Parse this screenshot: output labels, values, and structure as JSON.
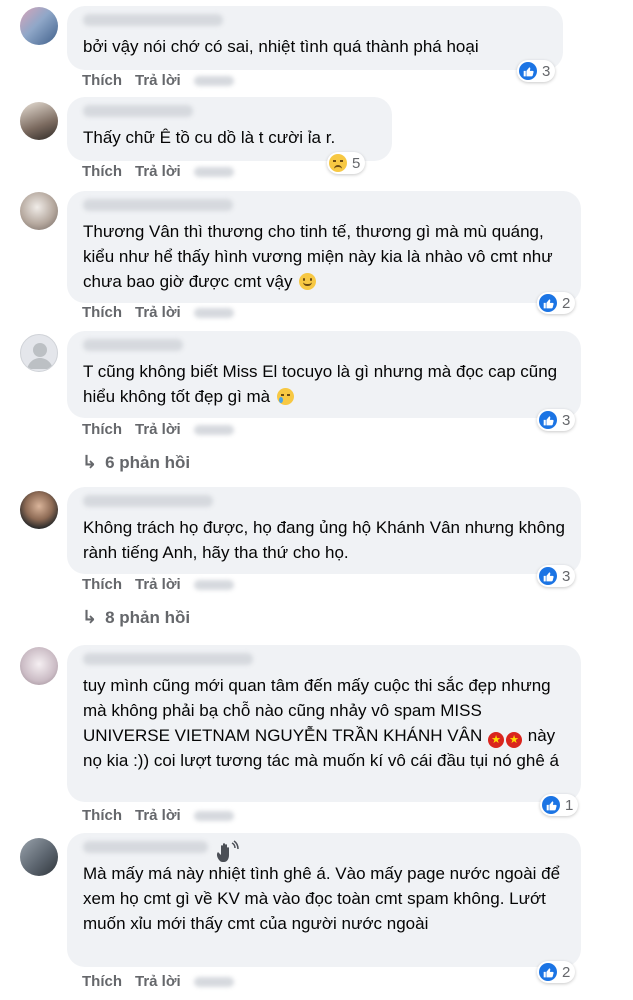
{
  "comments": [
    {
      "text": "bởi vậy nói chớ có sai, nhiệt tình quá thành phá hoại",
      "reaction": "like",
      "count": "3"
    },
    {
      "text": "Thấy chữ Ê tồ cu dồ là t cười ỉa r.",
      "reaction": "sad",
      "count": "5"
    },
    {
      "text": "Thương Vân thì thương cho tinh tế, thương gì mà mù quáng, kiểu như hể thấy hình vương miện này kia là nhào vô cmt như chưa bao giờ được cmt vậy",
      "reaction": "like",
      "count": "2"
    },
    {
      "text": "T cũng không biết Miss El tocuyo là gì nhưng mà đọc cap cũng hiểu không tốt đẹp gì mà",
      "reaction": "like",
      "count": "3",
      "replies": "6 phản hồi"
    },
    {
      "text": "Không trách họ được, họ đang ủng hộ Khánh Vân nhưng không rành tiếng Anh, hãy tha thứ cho họ.",
      "reaction": "like",
      "count": "3",
      "replies": "8 phản hồi"
    },
    {
      "text_part1": "tuy mình cũng mới quan tâm đến mấy cuộc thi sắc đẹp nhưng mà không phải bạ chỗ nào cũng nhảy vô spam MISS UNIVERSE VIETNAM NGUYỄN TRẦN KHÁNH VÂN",
      "text_part2": "này nọ kia :)) coi lượt tương tác mà muốn kí vô cái đầu tụi nó ghê á",
      "reaction": "like",
      "count": "1"
    },
    {
      "text": "Mà mấy má này nhiệt tình ghê á. Vào mấy page nước ngoài để xem họ cmt gì về KV mà vào đọc toàn cmt spam không. Lướt muốn xỉu mới thấy cmt của người nước ngoài",
      "reaction": "like",
      "count": "2"
    }
  ],
  "actions": {
    "like": "Thích",
    "reply": "Trả lời"
  },
  "icons": {
    "like": "like-icon",
    "sad": "sad-icon",
    "reply_arrow": "reply-arrow-icon",
    "wave": "waving-hand-icon",
    "flag": "vietnam-flag-icon"
  },
  "colors": {
    "bubble": "#f0f2f5",
    "like_blue": "#1b74e4",
    "meta_gray": "#65676b"
  }
}
